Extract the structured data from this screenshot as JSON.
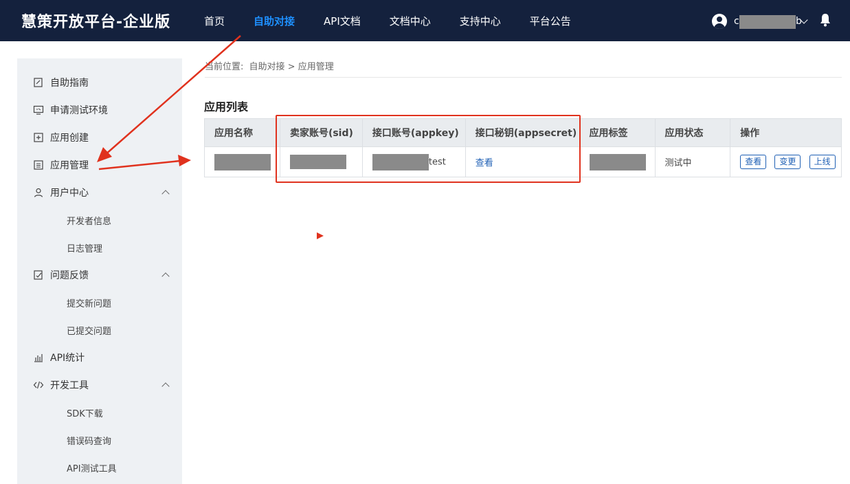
{
  "header": {
    "brand": "慧策开放平台-企业版",
    "nav": [
      "首页",
      "自助对接",
      "API文档",
      "文档中心",
      "支持中心",
      "平台公告"
    ],
    "active_nav": "自助对接",
    "username_visible": "c",
    "username_tail": "b"
  },
  "sidebar": {
    "items": [
      {
        "label": "自助指南",
        "icon": "guide-icon"
      },
      {
        "label": "申请测试环境",
        "icon": "monitor-icon"
      },
      {
        "label": "应用创建",
        "icon": "add-box-icon"
      },
      {
        "label": "应用管理",
        "icon": "list-box-icon"
      },
      {
        "label": "用户中心",
        "icon": "user-icon",
        "expanded": true
      },
      {
        "label": "开发者信息",
        "sub": true
      },
      {
        "label": "日志管理",
        "sub": true
      },
      {
        "label": "问题反馈",
        "icon": "feedback-icon",
        "expanded": true
      },
      {
        "label": "提交新问题",
        "sub": true
      },
      {
        "label": "已提交问题",
        "sub": true
      },
      {
        "label": "API统计",
        "icon": "bar-chart-icon"
      },
      {
        "label": "开发工具",
        "icon": "code-icon",
        "expanded": true
      },
      {
        "label": "SDK下载",
        "sub": true
      },
      {
        "label": "错误码查询",
        "sub": true
      },
      {
        "label": "API测试工具",
        "sub": true
      }
    ]
  },
  "breadcrumb": {
    "prefix": "当前位置:",
    "path": "自助对接 > 应用管理"
  },
  "main": {
    "title": "应用列表",
    "table": {
      "headers": [
        "应用名称",
        "卖家账号(sid)",
        "接口账号(appkey)",
        "接口秘钥(appsecret)",
        "应用标签",
        "应用状态",
        "操作"
      ],
      "rows": [
        {
          "appkey_suffix": "test",
          "secret_link": "查看",
          "status": "测试中",
          "actions": [
            "查看",
            "变更",
            "上线"
          ]
        }
      ]
    }
  },
  "colors": {
    "topbar": "#14213d",
    "active": "#1e90ff",
    "link": "#1e5fb4",
    "annotation": "#e0321e"
  }
}
